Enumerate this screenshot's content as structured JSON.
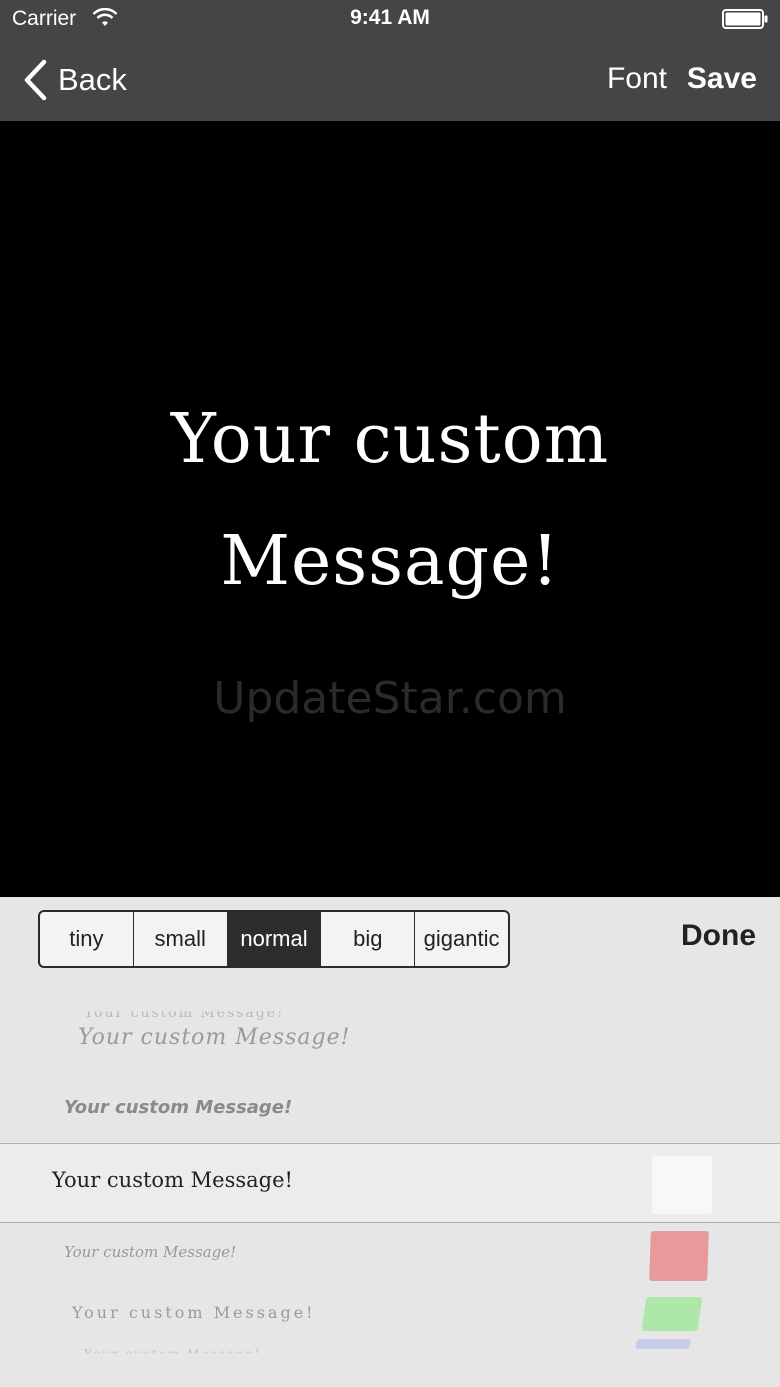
{
  "status_bar": {
    "carrier": "Carrier",
    "time": "9:41 AM"
  },
  "nav": {
    "back_label": "Back",
    "font_label": "Font",
    "save_label": "Save"
  },
  "canvas": {
    "message_line1": "Your custom",
    "message_line2": "Message!",
    "watermark": "UpdateStar.com"
  },
  "size_selector": {
    "options": [
      "tiny",
      "small",
      "normal",
      "big",
      "gigantic"
    ],
    "selected": "normal"
  },
  "done_label": "Done",
  "font_list": {
    "samples": [
      "Your custom Message!",
      "Your custom Message!",
      "Your custom Message!",
      "Your custom Message!",
      "Your custom Message!",
      "Your custom Message!",
      "Your custom Message!"
    ],
    "selected_sample": "Your custom Message!"
  },
  "colors": {
    "nav_bar": "#444547",
    "canvas_bg": "#000000",
    "message_text": "#ffffff",
    "swatches": [
      "#f8f8f8",
      "#e89a9a",
      "#aee8a8",
      "#c9cbeb"
    ]
  }
}
